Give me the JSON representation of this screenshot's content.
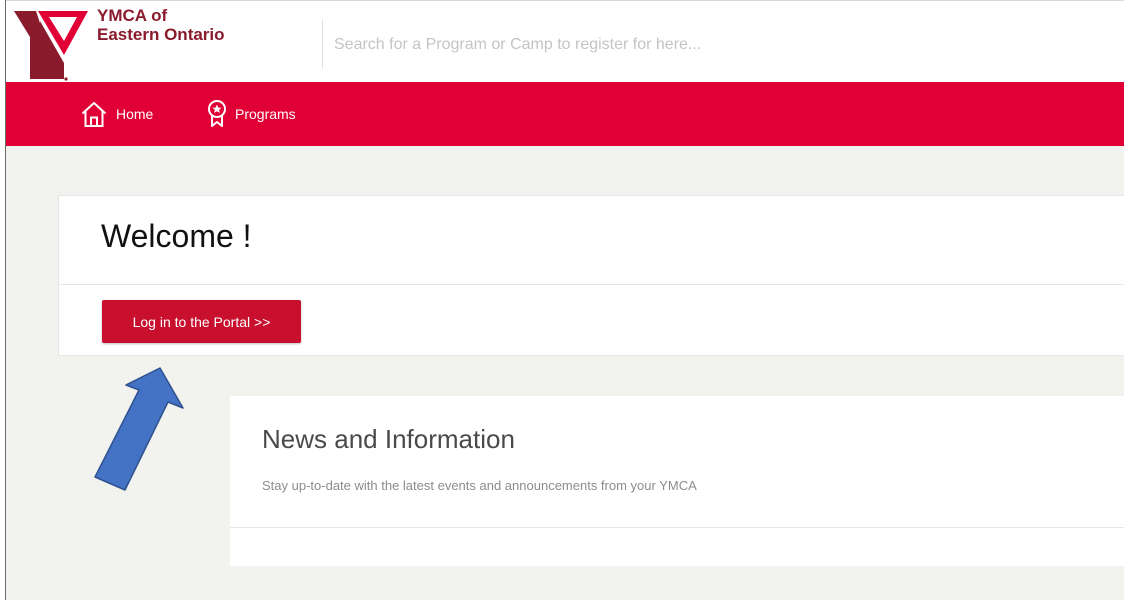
{
  "brand": {
    "line1": "YMCA of",
    "line2": "Eastern Ontario",
    "logo_icon": "ymca-y-logo-icon",
    "color": "#8a1b2c"
  },
  "search": {
    "placeholder": "Search for a Program or Camp to register for here...",
    "value": ""
  },
  "nav": {
    "items": [
      {
        "label": "Home",
        "icon": "home-icon"
      },
      {
        "label": "Programs",
        "icon": "ribbon-award-icon"
      }
    ],
    "color": "#e10036"
  },
  "welcome": {
    "title": "Welcome !",
    "login_label": "Log in to the Portal >>",
    "button_color": "#c8102e"
  },
  "news": {
    "title": "News and Information",
    "subtitle": "Stay up-to-date with the latest events and announcements from your YMCA"
  },
  "annotation": {
    "icon": "blue-arrow-pointer-icon",
    "color": "#4472c4"
  }
}
